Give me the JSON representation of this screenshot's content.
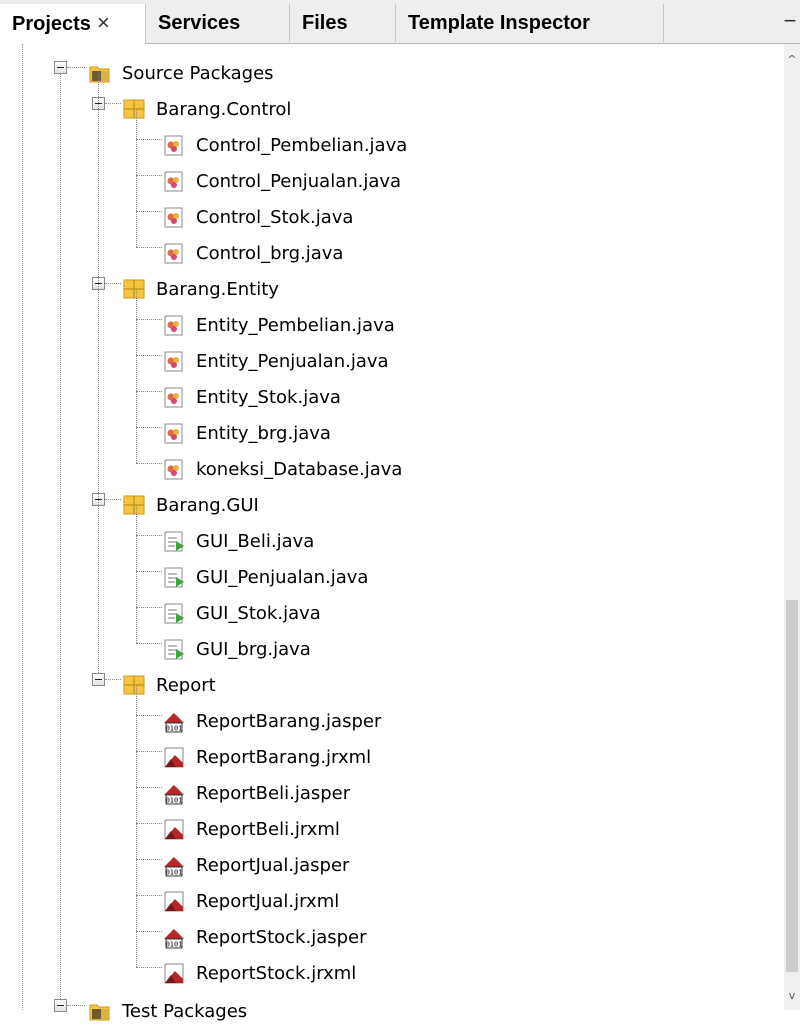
{
  "tabs": [
    {
      "label": "Projects",
      "active": true,
      "close": "×"
    },
    {
      "label": "Services",
      "active": false
    },
    {
      "label": "Files",
      "active": false
    },
    {
      "label": "Template Inspector",
      "active": false
    }
  ],
  "tab_menu_glyph": "−",
  "tree": {
    "source_packages": "Source Packages",
    "test_packages": "Test Packages",
    "packages": [
      {
        "name": "Barang.Control",
        "files": [
          "Control_Pembelian.java",
          "Control_Penjualan.java",
          "Control_Stok.java",
          "Control_brg.java"
        ],
        "icon": "java-class-icon"
      },
      {
        "name": "Barang.Entity",
        "files": [
          "Entity_Pembelian.java",
          "Entity_Penjualan.java",
          "Entity_Stok.java",
          "Entity_brg.java",
          "koneksi_Database.java"
        ],
        "icon": "java-class-icon"
      },
      {
        "name": "Barang.GUI",
        "files": [
          "GUI_Beli.java",
          "GUI_Penjualan.java",
          "GUI_Stok.java",
          "GUI_brg.java"
        ],
        "icon": "java-form-icon"
      },
      {
        "name": "Report",
        "files": [
          "ReportBarang.jasper",
          "ReportBarang.jrxml",
          "ReportBeli.jasper",
          "ReportBeli.jrxml",
          "ReportJual.jasper",
          "ReportJual.jrxml",
          "ReportStock.jasper",
          "ReportStock.jrxml"
        ],
        "icon": "report-icon"
      }
    ]
  },
  "colors": {
    "package_fill": "#f5c542",
    "package_stroke": "#c79a1e",
    "jasper_red": "#b3262a",
    "gui_green": "#3fa43a"
  }
}
